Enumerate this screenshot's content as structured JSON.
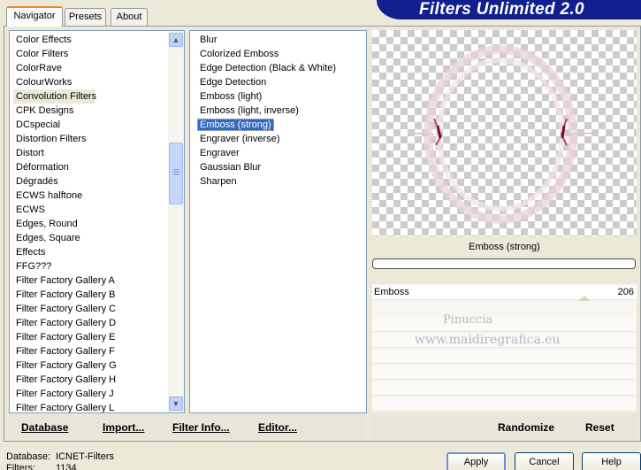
{
  "tabs": [
    "Navigator",
    "Presets",
    "About"
  ],
  "app_title": "Filters Unlimited 2.0",
  "categories": [
    "Color Effects",
    "Color Filters",
    "ColorRave",
    "ColourWorks",
    "Convolution Filters",
    "CPK Designs",
    "DCspecial",
    "Distortion Filters",
    "Distort",
    "Déformation",
    "Dégradés",
    "ECWS halftone",
    "ECWS",
    "Edges, Round",
    "Edges, Square",
    "Effects",
    "FFG???",
    "Filter Factory Gallery A",
    "Filter Factory Gallery B",
    "Filter Factory Gallery C",
    "Filter Factory Gallery D",
    "Filter Factory Gallery E",
    "Filter Factory Gallery F",
    "Filter Factory Gallery G",
    "Filter Factory Gallery H",
    "Filter Factory Gallery J",
    "Filter Factory Gallery L"
  ],
  "selected_category": "Convolution Filters",
  "filters": [
    "Blur",
    "Colorized Emboss",
    "Edge Detection (Black & White)",
    "Edge Detection",
    "Emboss (light)",
    "Emboss (light, inverse)",
    "Emboss (strong)",
    "Engraver (inverse)",
    "Engraver",
    "Gaussian Blur",
    "Sharpen"
  ],
  "selected_filter": "Emboss (strong)",
  "preview": {
    "filter_label": "Emboss (strong)"
  },
  "params": [
    {
      "name": "Emboss",
      "value": "206"
    }
  ],
  "watermark": {
    "line1": "Pinuccia",
    "line2": "www.maidiregrafica.eu"
  },
  "toolbar": {
    "database": "Database",
    "import": "Import...",
    "filter_info": "Filter Info...",
    "editor": "Editor...",
    "randomize": "Randomize",
    "reset": "Reset"
  },
  "status": {
    "database_label": "Database:",
    "database_value": "ICNET-Filters",
    "filters_label": "Filters:",
    "filters_value": "1134"
  },
  "buttons": {
    "apply": "Apply",
    "cancel": "Cancel",
    "help": "Help"
  },
  "colors": {
    "banner": "#10208c",
    "selection": "#316ac5",
    "tab_accent": "#e68b2c"
  }
}
